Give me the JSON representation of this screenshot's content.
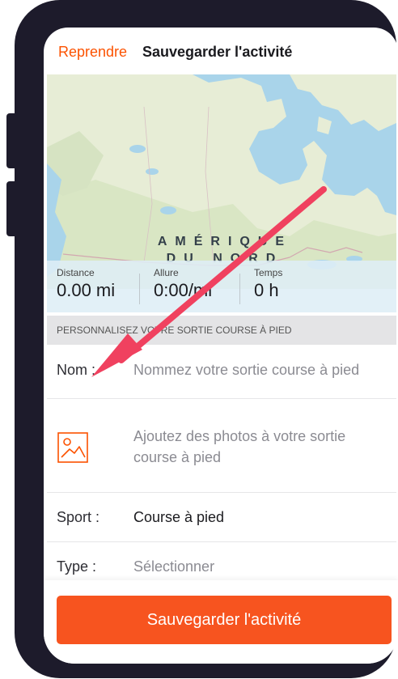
{
  "header": {
    "back_label": "Reprendre",
    "title": "Sauvegarder l'activité"
  },
  "map": {
    "label_line1": "AMÉRIQUE",
    "label_line2": "DU NORD"
  },
  "stats": [
    {
      "label": "Distance",
      "value": "0.00 mi"
    },
    {
      "label": "Allure",
      "value": "0:00/mi"
    },
    {
      "label": "Temps",
      "value": "0 h"
    }
  ],
  "section_header": "PERSONNALISEZ VOTRE SORTIE COURSE À PIED",
  "form": {
    "name_label": "Nom :",
    "name_placeholder": "Nommez votre sortie course à pied",
    "photos_placeholder": "Ajoutez des photos à votre sortie course à pied",
    "sport_label": "Sport :",
    "sport_value": "Course à pied",
    "type_label": "Type :",
    "type_placeholder": "Sélectionner"
  },
  "save_button_label": "Sauvegarder l'activité",
  "colors": {
    "accent": "#fc5200",
    "button": "#f7541f",
    "arrow": "#f0415f",
    "device_frame": "#1d1b2b"
  },
  "icons": {
    "photo": "image-icon",
    "annotation": "arrow-annotation"
  }
}
